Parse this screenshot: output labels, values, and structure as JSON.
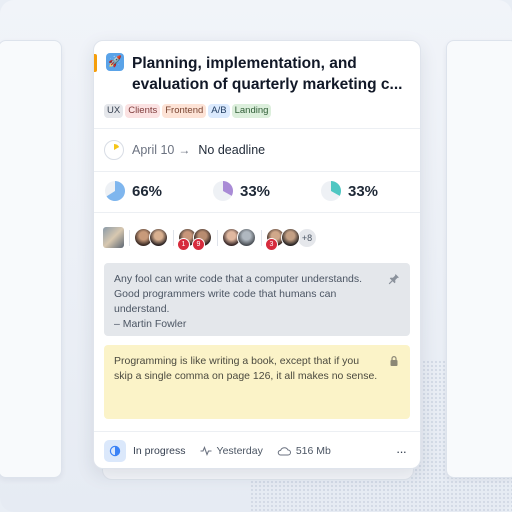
{
  "card": {
    "title": "Planning, implementation, and evaluation of quarterly marketing c...",
    "app_icon": "rocket-icon",
    "accent_color": "#f59e0b",
    "tags": [
      {
        "label": "UX"
      },
      {
        "label": "Clients"
      },
      {
        "label": "Frontend"
      },
      {
        "label": "A/B"
      },
      {
        "label": "Landing"
      }
    ],
    "dates": {
      "start": "April 10",
      "arrow": "→",
      "deadline": "No deadline"
    },
    "progress": [
      {
        "label": "66%",
        "value": 0.66,
        "color": "#7fb6ee"
      },
      {
        "label": "33%",
        "value": 0.33,
        "color": "#a98bd6"
      },
      {
        "label": "33%",
        "value": 0.33,
        "color": "#4fc7c2"
      }
    ],
    "people": {
      "group_badges": [
        "1",
        "9",
        "3"
      ],
      "more": "+8"
    },
    "notes": [
      {
        "text_line1": "Any fool can write code that a computer understands.",
        "text_line2": "Good programmers write code that humans can",
        "text_line3": "understand.",
        "text_line4": "– Martin Fowler",
        "icon": "pin-icon"
      },
      {
        "text_line1": "Programming is like writing a book, except that if you",
        "text_line2": "skip a single comma on page 126, it all makes no sense.",
        "icon": "lock-icon"
      }
    ],
    "footer": {
      "status": "In progress",
      "activity": "Yesterday",
      "size": "516 Mb",
      "menu": "···"
    }
  }
}
